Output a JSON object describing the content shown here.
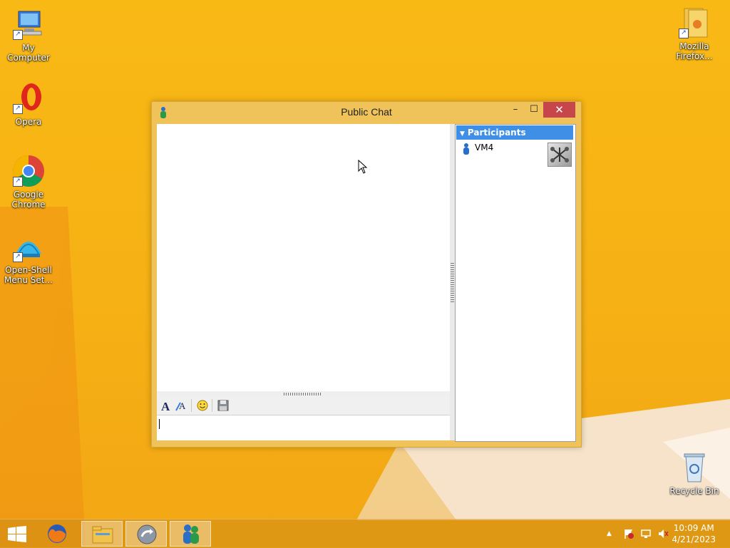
{
  "desktop": {
    "icons": [
      {
        "label": "My Computer"
      },
      {
        "label": "Opera"
      },
      {
        "label": "Google Chrome"
      },
      {
        "label": "Open-Shell Menu Set..."
      },
      {
        "label": "Mozilla Firefox..."
      },
      {
        "label": "Recycle Bin"
      }
    ]
  },
  "window": {
    "title": "Public Chat",
    "minimize": "–",
    "maximize": "☐",
    "close": "✕"
  },
  "participants": {
    "header": "Participants",
    "items": [
      {
        "name": "VM4"
      }
    ]
  },
  "taskbar": {
    "time": "10:09 AM",
    "date": "4/21/2023",
    "tray_arrow": "▲"
  },
  "colors": {
    "accent_header": "#3f8fe6",
    "close_button": "#c7464b",
    "desktop": "#f7b416"
  }
}
